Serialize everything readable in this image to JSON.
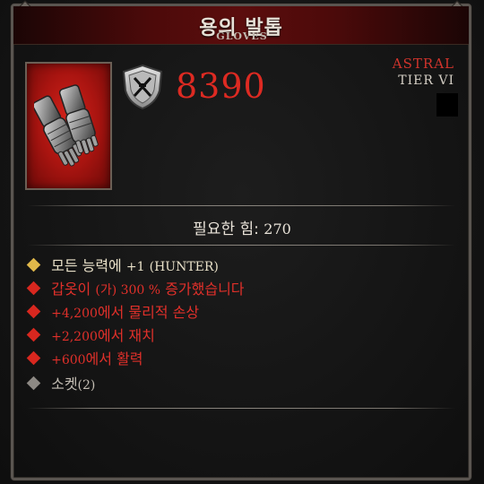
{
  "item": {
    "name": "용의 발톱",
    "type": "GLOVES",
    "item_power": "8390",
    "rarity": "ASTRAL",
    "tier": "TIER VI",
    "requirement_label": "필요한 힘:",
    "requirement_value": "270"
  },
  "affixes": [
    {
      "prefix": "모든 능력에",
      "value": "+1",
      "suffix": "(HUNTER)",
      "kind": "gold"
    },
    {
      "prefix": "갑옷이",
      "value": "(가) 300 %",
      "suffix": "증가했습니다",
      "kind": "red"
    },
    {
      "value": "+4,200",
      "text": "에서 물리적 손상",
      "kind": "red"
    },
    {
      "value": "+2,200",
      "text": "에서 재치",
      "kind": "red"
    },
    {
      "value": "+600",
      "text": "에서 활력",
      "kind": "red"
    },
    {
      "prefix": "소켓",
      "value": "(2)",
      "kind": "grey"
    }
  ],
  "colors": {
    "rarity": "#d0342c",
    "power": "#dd2a22",
    "affix_red": "#e0302a",
    "affix_gold_bullet": "#e0b84a"
  },
  "icons": [
    "shield-icon",
    "gloves-icon"
  ]
}
